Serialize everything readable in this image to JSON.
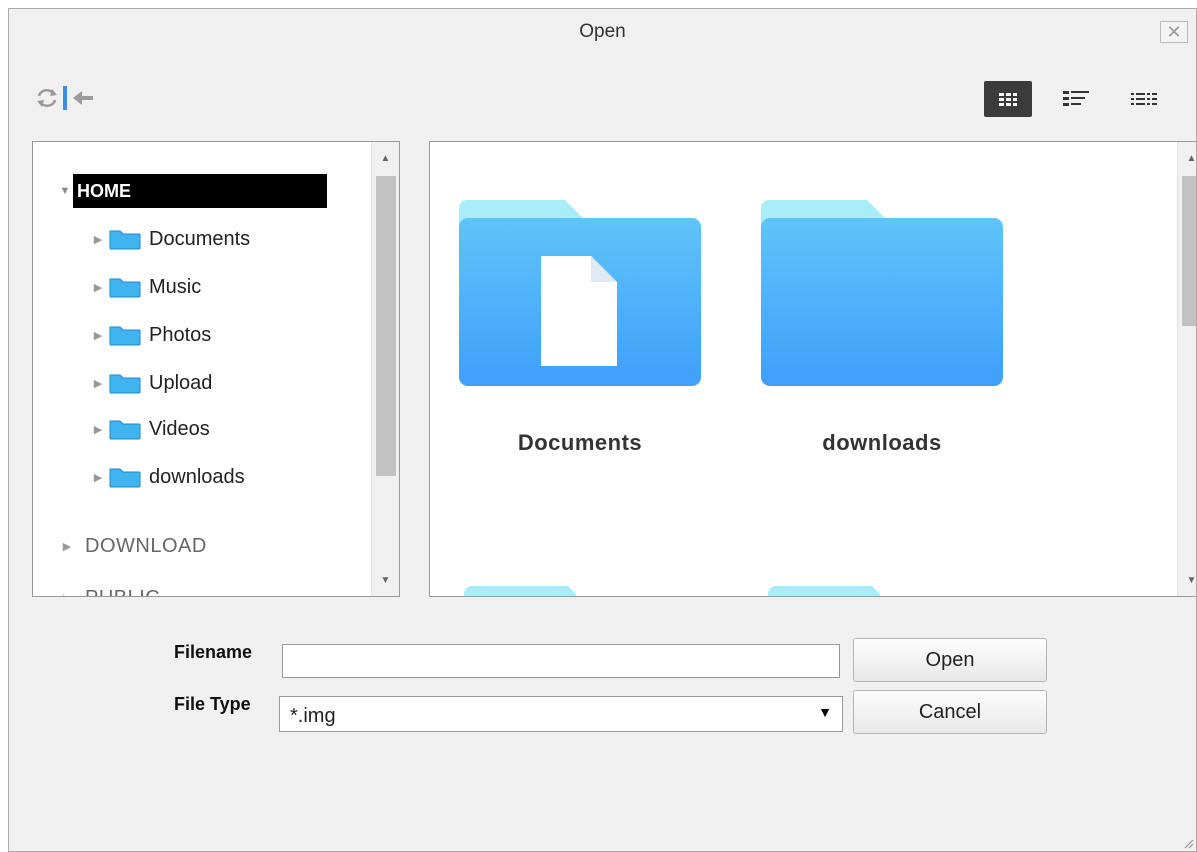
{
  "window": {
    "title": "Open",
    "close_glyph": "✕"
  },
  "toolbar": {
    "left_icons": [
      "refresh-icon",
      "back-icon"
    ],
    "view_icons": [
      "large-icons-view-icon",
      "details-view-icon",
      "list-view-icon"
    ],
    "active_view": "large-icons-view-icon",
    "accent": "#3a8ee6"
  },
  "tree": {
    "root": {
      "label": "HOME",
      "expanded": true
    },
    "children": [
      {
        "label": "Documents"
      },
      {
        "label": "Music"
      },
      {
        "label": "Photos"
      },
      {
        "label": "Upload"
      },
      {
        "label": "Videos"
      },
      {
        "label": "downloads"
      }
    ],
    "other_roots": [
      {
        "label": "DOWNLOAD"
      },
      {
        "label": "PUBLIC"
      }
    ]
  },
  "files": {
    "items": [
      {
        "name": "Documents",
        "icon": "folder-with-document-icon"
      },
      {
        "name": "downloads",
        "icon": "folder-icon"
      }
    ],
    "folder_colors": {
      "tab": "#a9ecfa",
      "body_top": "#5fc4f8",
      "body_bottom": "#3f9ffb"
    }
  },
  "form": {
    "filename_label": "Filename",
    "filename_value": "",
    "filetype_label": "File Type",
    "filetype_value": "*.img",
    "open_label": "Open",
    "cancel_label": "Cancel"
  }
}
